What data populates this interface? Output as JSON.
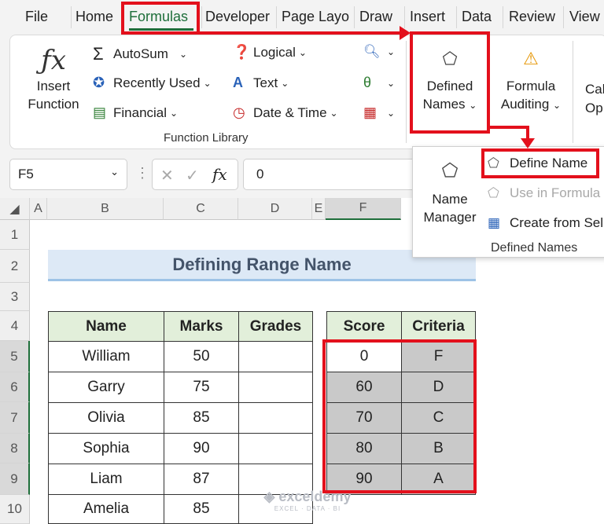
{
  "tabs": [
    "File",
    "Home",
    "Formulas",
    "Developer",
    "Page Layout",
    "Draw",
    "Insert",
    "Data",
    "Review",
    "View"
  ],
  "ribbon": {
    "insert_function": [
      "Insert",
      "Function"
    ],
    "autosum": "AutoSum",
    "recently_used": "Recently Used",
    "financial": "Financial",
    "logical": "Logical",
    "text": "Text",
    "date_time": "Date & Time",
    "function_library": "Function Library",
    "defined_names": [
      "Defined",
      "Names"
    ],
    "formula_auditing": [
      "Formula",
      "Auditing"
    ],
    "calc": [
      "Cal",
      "Op"
    ]
  },
  "formula_bar": {
    "cell_ref": "F5",
    "fx": "fx",
    "value": "0"
  },
  "popup": {
    "name_manager": [
      "Name",
      "Manager"
    ],
    "define_name": "Define Name",
    "use_in_formula": "Use in Formula",
    "create_from_selection": "Create from Sel",
    "group_label": "Defined Names"
  },
  "columns": [
    "A",
    "B",
    "C",
    "D",
    "E",
    "F"
  ],
  "rows": [
    "1",
    "2",
    "3",
    "4",
    "5",
    "6",
    "7",
    "8",
    "9",
    "10"
  ],
  "title": "Defining Range Name",
  "table1": {
    "headers": [
      "Name",
      "Marks",
      "Grades"
    ],
    "rows": [
      [
        "William",
        "50",
        ""
      ],
      [
        "Garry",
        "75",
        ""
      ],
      [
        "Olivia",
        "85",
        ""
      ],
      [
        "Sophia",
        "90",
        ""
      ],
      [
        "Liam",
        "87",
        ""
      ],
      [
        "Amelia",
        "85",
        ""
      ]
    ]
  },
  "table2": {
    "headers": [
      "Score",
      "Criteria"
    ],
    "rows": [
      [
        "0",
        "F"
      ],
      [
        "60",
        "D"
      ],
      [
        "70",
        "C"
      ],
      [
        "80",
        "B"
      ],
      [
        "90",
        "A"
      ]
    ]
  },
  "watermark": "exceldemy",
  "watermark_sub": "EXCEL · DATA · BI",
  "colors": {
    "accent": "#1e6e3a",
    "highlight": "#e3101c",
    "header_fill": "#e2efda",
    "title_fill": "#dde9f6",
    "grey_fill": "#c9c9c9"
  }
}
